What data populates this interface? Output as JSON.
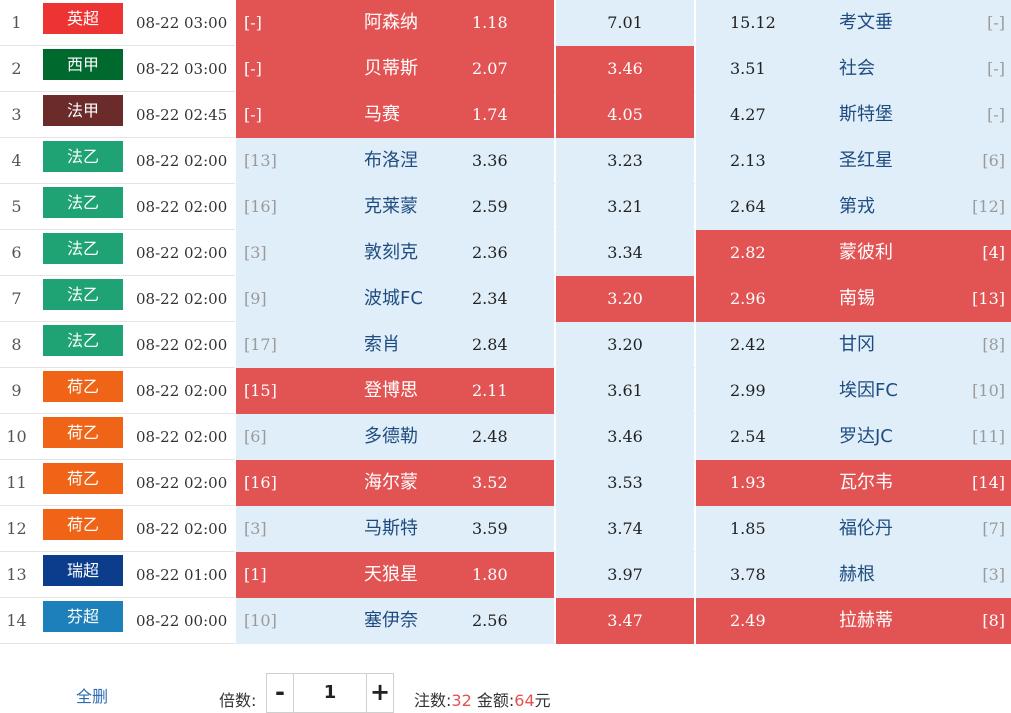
{
  "colors": {
    "selected": "#e25353",
    "unselected": "#e0eef9",
    "leagues": {
      "英超": "#ee3333",
      "西甲": "#006a2e",
      "法甲": "#6b2b2b",
      "法乙": "#1fa274",
      "荷乙": "#f06418",
      "瑞超": "#0b3d8c",
      "芬超": "#1e80ba"
    }
  },
  "rows": [
    {
      "idx": "1",
      "league": "英超",
      "time": "08-22 03:00",
      "home_rank": "[-]",
      "home": "阿森纳",
      "odd_win": "1.18",
      "odd_draw": "7.01",
      "odd_lose": "15.12",
      "away": "考文垂",
      "away_rank": "[-]",
      "sel_home": true,
      "sel_draw": false,
      "sel_away": false
    },
    {
      "idx": "2",
      "league": "西甲",
      "time": "08-22 03:00",
      "home_rank": "[-]",
      "home": "贝蒂斯",
      "odd_win": "2.07",
      "odd_draw": "3.46",
      "odd_lose": "3.51",
      "away": "社会",
      "away_rank": "[-]",
      "sel_home": true,
      "sel_draw": true,
      "sel_away": false
    },
    {
      "idx": "3",
      "league": "法甲",
      "time": "08-22 02:45",
      "home_rank": "[-]",
      "home": "马赛",
      "odd_win": "1.74",
      "odd_draw": "4.05",
      "odd_lose": "4.27",
      "away": "斯特堡",
      "away_rank": "[-]",
      "sel_home": true,
      "sel_draw": true,
      "sel_away": false
    },
    {
      "idx": "4",
      "league": "法乙",
      "time": "08-22 02:00",
      "home_rank": "[13]",
      "home": "布洛涅",
      "odd_win": "3.36",
      "odd_draw": "3.23",
      "odd_lose": "2.13",
      "away": "圣红星",
      "away_rank": "[6]",
      "sel_home": false,
      "sel_draw": false,
      "sel_away": false
    },
    {
      "idx": "5",
      "league": "法乙",
      "time": "08-22 02:00",
      "home_rank": "[16]",
      "home": "克莱蒙",
      "odd_win": "2.59",
      "odd_draw": "3.21",
      "odd_lose": "2.64",
      "away": "第戎",
      "away_rank": "[12]",
      "sel_home": false,
      "sel_draw": false,
      "sel_away": false
    },
    {
      "idx": "6",
      "league": "法乙",
      "time": "08-22 02:00",
      "home_rank": "[3]",
      "home": "敦刻克",
      "odd_win": "2.36",
      "odd_draw": "3.34",
      "odd_lose": "2.82",
      "away": "蒙彼利",
      "away_rank": "[4]",
      "sel_home": false,
      "sel_draw": false,
      "sel_away": true
    },
    {
      "idx": "7",
      "league": "法乙",
      "time": "08-22 02:00",
      "home_rank": "[9]",
      "home": "波城FC",
      "odd_win": "2.34",
      "odd_draw": "3.20",
      "odd_lose": "2.96",
      "away": "南锡",
      "away_rank": "[13]",
      "sel_home": false,
      "sel_draw": true,
      "sel_away": true
    },
    {
      "idx": "8",
      "league": "法乙",
      "time": "08-22 02:00",
      "home_rank": "[17]",
      "home": "索肖",
      "odd_win": "2.84",
      "odd_draw": "3.20",
      "odd_lose": "2.42",
      "away": "甘冈",
      "away_rank": "[8]",
      "sel_home": false,
      "sel_draw": false,
      "sel_away": false
    },
    {
      "idx": "9",
      "league": "荷乙",
      "time": "08-22 02:00",
      "home_rank": "[15]",
      "home": "登博思",
      "odd_win": "2.11",
      "odd_draw": "3.61",
      "odd_lose": "2.99",
      "away": "埃因FC",
      "away_rank": "[10]",
      "sel_home": true,
      "sel_draw": false,
      "sel_away": false
    },
    {
      "idx": "10",
      "league": "荷乙",
      "time": "08-22 02:00",
      "home_rank": "[6]",
      "home": "多德勒",
      "odd_win": "2.48",
      "odd_draw": "3.46",
      "odd_lose": "2.54",
      "away": "罗达JC",
      "away_rank": "[11]",
      "sel_home": false,
      "sel_draw": false,
      "sel_away": false
    },
    {
      "idx": "11",
      "league": "荷乙",
      "time": "08-22 02:00",
      "home_rank": "[16]",
      "home": "海尔蒙",
      "odd_win": "3.52",
      "odd_draw": "3.53",
      "odd_lose": "1.93",
      "away": "瓦尔韦",
      "away_rank": "[14]",
      "sel_home": true,
      "sel_draw": false,
      "sel_away": true
    },
    {
      "idx": "12",
      "league": "荷乙",
      "time": "08-22 02:00",
      "home_rank": "[3]",
      "home": "马斯特",
      "odd_win": "3.59",
      "odd_draw": "3.74",
      "odd_lose": "1.85",
      "away": "福伦丹",
      "away_rank": "[7]",
      "sel_home": false,
      "sel_draw": false,
      "sel_away": false
    },
    {
      "idx": "13",
      "league": "瑞超",
      "time": "08-22 01:00",
      "home_rank": "[1]",
      "home": "天狼星",
      "odd_win": "1.80",
      "odd_draw": "3.97",
      "odd_lose": "3.78",
      "away": "赫根",
      "away_rank": "[3]",
      "sel_home": true,
      "sel_draw": false,
      "sel_away": false
    },
    {
      "idx": "14",
      "league": "芬超",
      "time": "08-22 00:00",
      "home_rank": "[10]",
      "home": "塞伊奈",
      "odd_win": "2.56",
      "odd_draw": "3.47",
      "odd_lose": "2.49",
      "away": "拉赫蒂",
      "away_rank": "[8]",
      "sel_home": false,
      "sel_draw": true,
      "sel_away": true
    }
  ],
  "footer": {
    "delete_all": "全删",
    "multiplier_label": "倍数:",
    "minus": "-",
    "multiplier_value": "1",
    "plus": "+",
    "bets_label": "注数:",
    "bets_value": "32",
    "amount_label": "金额:",
    "amount_value": "64",
    "amount_unit": "元"
  }
}
